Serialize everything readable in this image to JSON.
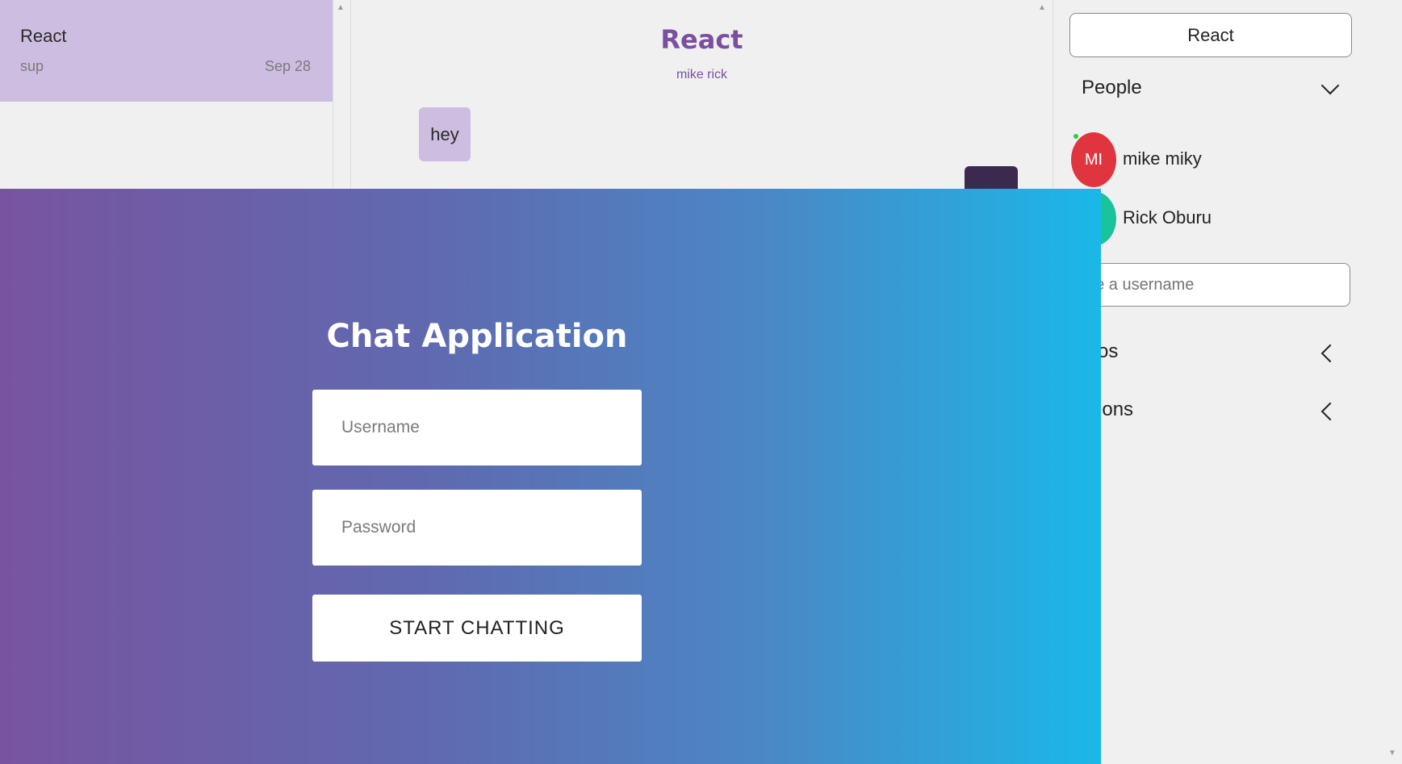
{
  "chat_list": {
    "items": [
      {
        "title": "React",
        "preview": "sup",
        "date": "Sep 28"
      }
    ]
  },
  "chat_feed": {
    "title": "React",
    "subtitle": "mike rick",
    "messages": [
      {
        "text": "hey"
      }
    ]
  },
  "chat_settings": {
    "chat_name": "React",
    "people_header": "People",
    "people": [
      {
        "initials": "MI",
        "name": "mike miky",
        "avatar_color": "#e0353f",
        "online": true
      },
      {
        "initials": "",
        "name": "Rick Oburu",
        "avatar_color": "#19c49c",
        "online": false
      }
    ],
    "search_placeholder": "Type a username",
    "visible_search_placeholder": "pe a username",
    "photos_header": "otos",
    "options_header": "otions"
  },
  "login": {
    "title": "Chat Application",
    "username_placeholder": "Username",
    "password_placeholder": "Password",
    "submit_label": "START CHATTING",
    "gradient_start": "#7854a0",
    "gradient_end": "#1ab8e8"
  }
}
